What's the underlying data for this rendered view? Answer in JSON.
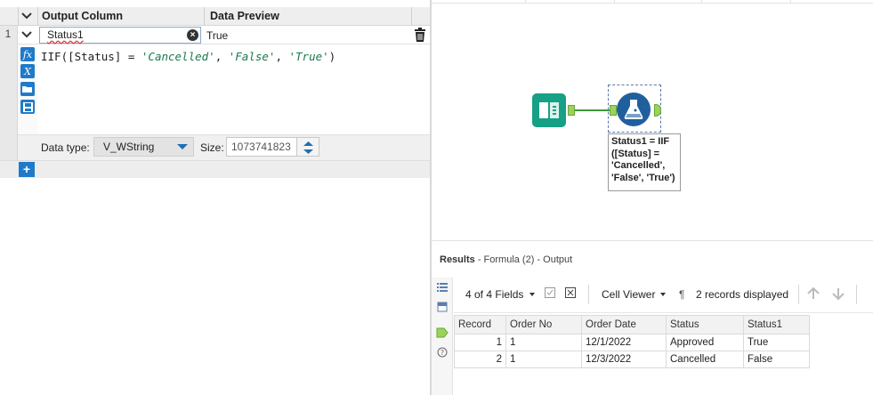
{
  "formula_config": {
    "columns": {
      "output_column": "Output Column",
      "data_preview": "Data Preview"
    },
    "row": {
      "number": "1",
      "output_name": "Status1",
      "preview": "True",
      "expression": {
        "prefix": "IIF([Status] = ",
        "arg1": "'Cancelled'",
        "sep1": ", ",
        "arg2": "'False'",
        "sep2": ", ",
        "arg3": "'True'",
        "suffix": ")"
      },
      "data_type_label": "Data type:",
      "data_type": "V_WString",
      "size_label": "Size:",
      "size": "1073741823"
    },
    "side_icons": [
      "fx-icon",
      "variable-icon",
      "open-icon",
      "save-icon"
    ],
    "add_button": "+"
  },
  "canvas": {
    "formula_annotation": "Status1 = IIF\n([Status] =\n'Cancelled',\n'False', 'True')"
  },
  "results": {
    "title": "Results",
    "subtitle": "- Formula (2) - Output",
    "toolbar": {
      "fields": "4 of 4 Fields",
      "viewer": "Cell Viewer",
      "records": "2 records displayed"
    },
    "table": {
      "headers": [
        "Record",
        "Order No",
        "Order Date",
        "Status",
        "Status1"
      ],
      "rows": [
        [
          "1",
          "1",
          "12/1/2022",
          "Approved",
          "True"
        ],
        [
          "2",
          "1",
          "12/3/2022",
          "Cancelled",
          "False"
        ]
      ]
    }
  },
  "colors": {
    "accent_blue": "#1f7ac9",
    "input_tool": "#16a085",
    "formula_tool": "#1f5f9e",
    "string_literal": "#1a7a4c"
  }
}
